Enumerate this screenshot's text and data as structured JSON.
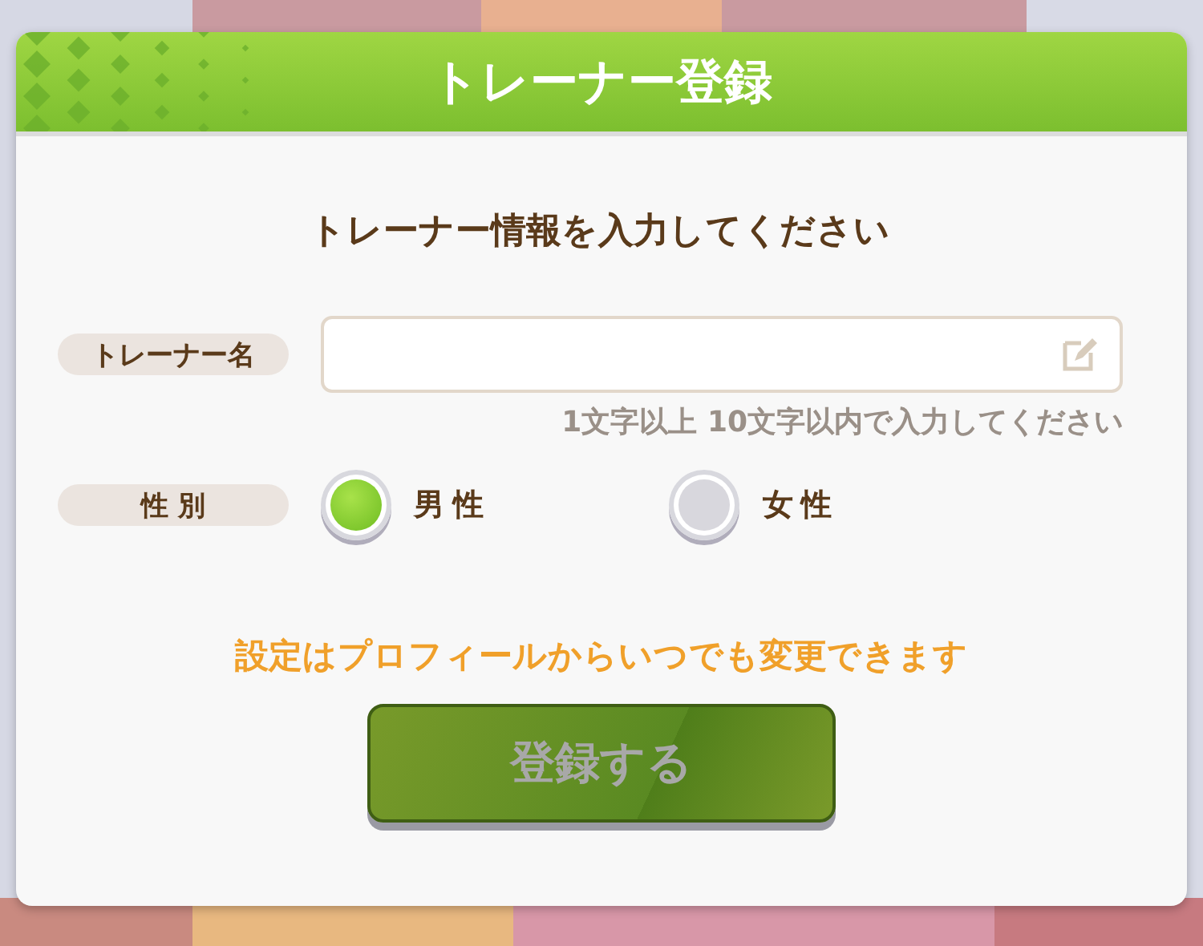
{
  "dialog": {
    "title": "トレーナー登録",
    "heading": "トレーナー情報を入力してください",
    "name_field": {
      "label": "トレーナー名",
      "hint": "1文字以上 10文字以内で入力してください"
    },
    "gender": {
      "label": "性 別",
      "options": [
        {
          "label": "男 性",
          "selected": true
        },
        {
          "label": "女 性",
          "selected": false
        }
      ]
    },
    "notice": "設定はプロフィールからいつでも変更できます",
    "submit": {
      "label": "登録する",
      "disabled": true
    }
  }
}
